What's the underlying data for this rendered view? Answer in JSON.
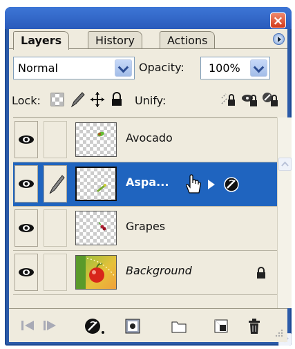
{
  "window": {
    "close_label": "×"
  },
  "tabs": [
    {
      "label": "Layers",
      "active": true
    },
    {
      "label": "History",
      "active": false
    },
    {
      "label": "Actions",
      "active": false
    }
  ],
  "blend_mode": {
    "value": "Normal"
  },
  "opacity": {
    "label": "Opacity:",
    "value": "100%"
  },
  "lock": {
    "label": "Lock:"
  },
  "unify": {
    "label": "Unify:"
  },
  "layers": [
    {
      "name": "Avocado",
      "visible": true,
      "selected": false,
      "icon": "none"
    },
    {
      "name": "Aspa...",
      "visible": true,
      "selected": true,
      "icon": "paint-brush-icon"
    },
    {
      "name": "Grapes",
      "visible": true,
      "selected": false,
      "icon": "none"
    },
    {
      "name": "Background",
      "visible": true,
      "selected": false,
      "locked": true,
      "italic": true
    }
  ],
  "colors": {
    "selection": "#1f64bf",
    "title_blue": "#2a5bbb",
    "panel": "#efebde"
  }
}
